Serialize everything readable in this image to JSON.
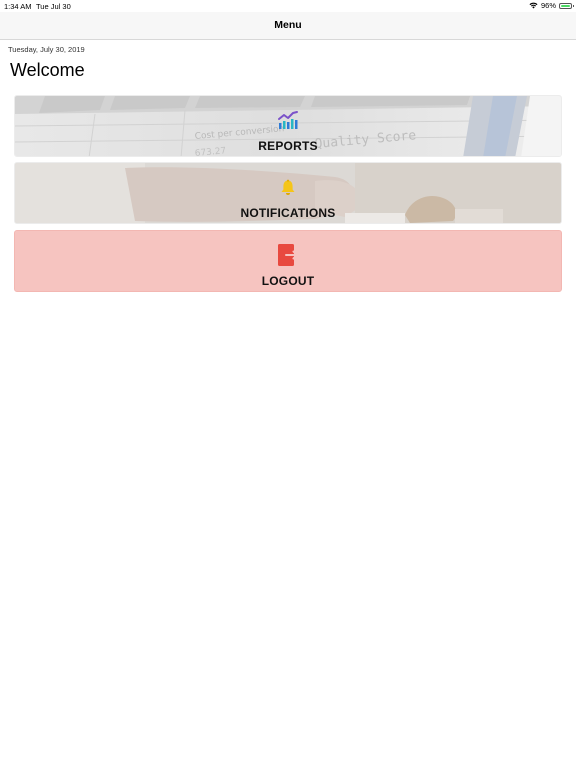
{
  "status_bar": {
    "time": "1:34 AM",
    "date": "Tue Jul 30",
    "battery_percent": "96%",
    "battery_level": 0.96
  },
  "nav": {
    "title": "Menu"
  },
  "header": {
    "date": "Tuesday, July 30, 2019",
    "welcome": "Welcome"
  },
  "menu": {
    "items": [
      {
        "label": "REPORTS",
        "icon": "chart-icon",
        "background_text": [
          "Cost per conversion",
          "Quality Score",
          "673.27"
        ]
      },
      {
        "label": "NOTIFICATIONS",
        "icon": "bell-icon"
      },
      {
        "label": "LOGOUT",
        "icon": "logout-icon",
        "color": "#f6c4c0"
      }
    ]
  },
  "colors": {
    "logout_bg": "#f6c4c0",
    "logout_icon": "#e8493f",
    "bell": "#f5c518",
    "chart_blue": "#2e7bd6",
    "chart_teal": "#27b7c4",
    "chart_purple": "#7b52c9"
  }
}
